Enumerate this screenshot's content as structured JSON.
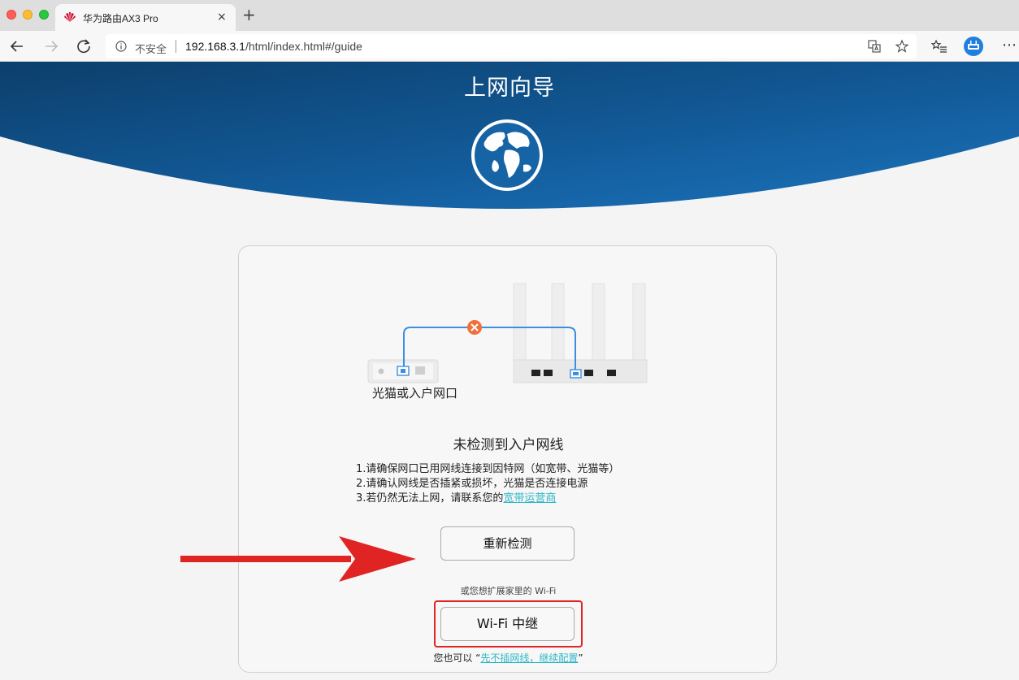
{
  "browser": {
    "tab_title": "华为路由AX3 Pro",
    "tab_close": "×",
    "new_tab": "+",
    "security_label": "不安全",
    "url_host": "192.168.3.1",
    "url_path": "/html/index.html#/guide",
    "menu": "⋯"
  },
  "page": {
    "title": "上网向导",
    "modem_label": "光猫或入户网口",
    "status_title": "未检测到入户网线",
    "tips": {
      "line1": "1.请确保网口已用网线连接到因特网（如宽带、光猫等）",
      "line2": "2.请确认网线是否插紧或损坏，光猫是否连接电源",
      "line3_prefix": "3.若仍然无法上网，请联系您的",
      "line3_link": "宽带运营商"
    },
    "redetect_button": "重新检测",
    "extend_text": "或您想扩展家里的 Wi-Fi",
    "repeater_button": "Wi-Fi 中继",
    "skip_prefix": "您也可以 “",
    "skip_link": "先不插网线，继续配置",
    "skip_suffix": "”"
  },
  "colors": {
    "hero_dark": "#0e4a7a",
    "hero_light": "#1a6bb0",
    "link": "#2fb7c6",
    "highlight_red": "#e02424",
    "cable_blue": "#3b8fe0",
    "error_orange": "#f0703a"
  }
}
